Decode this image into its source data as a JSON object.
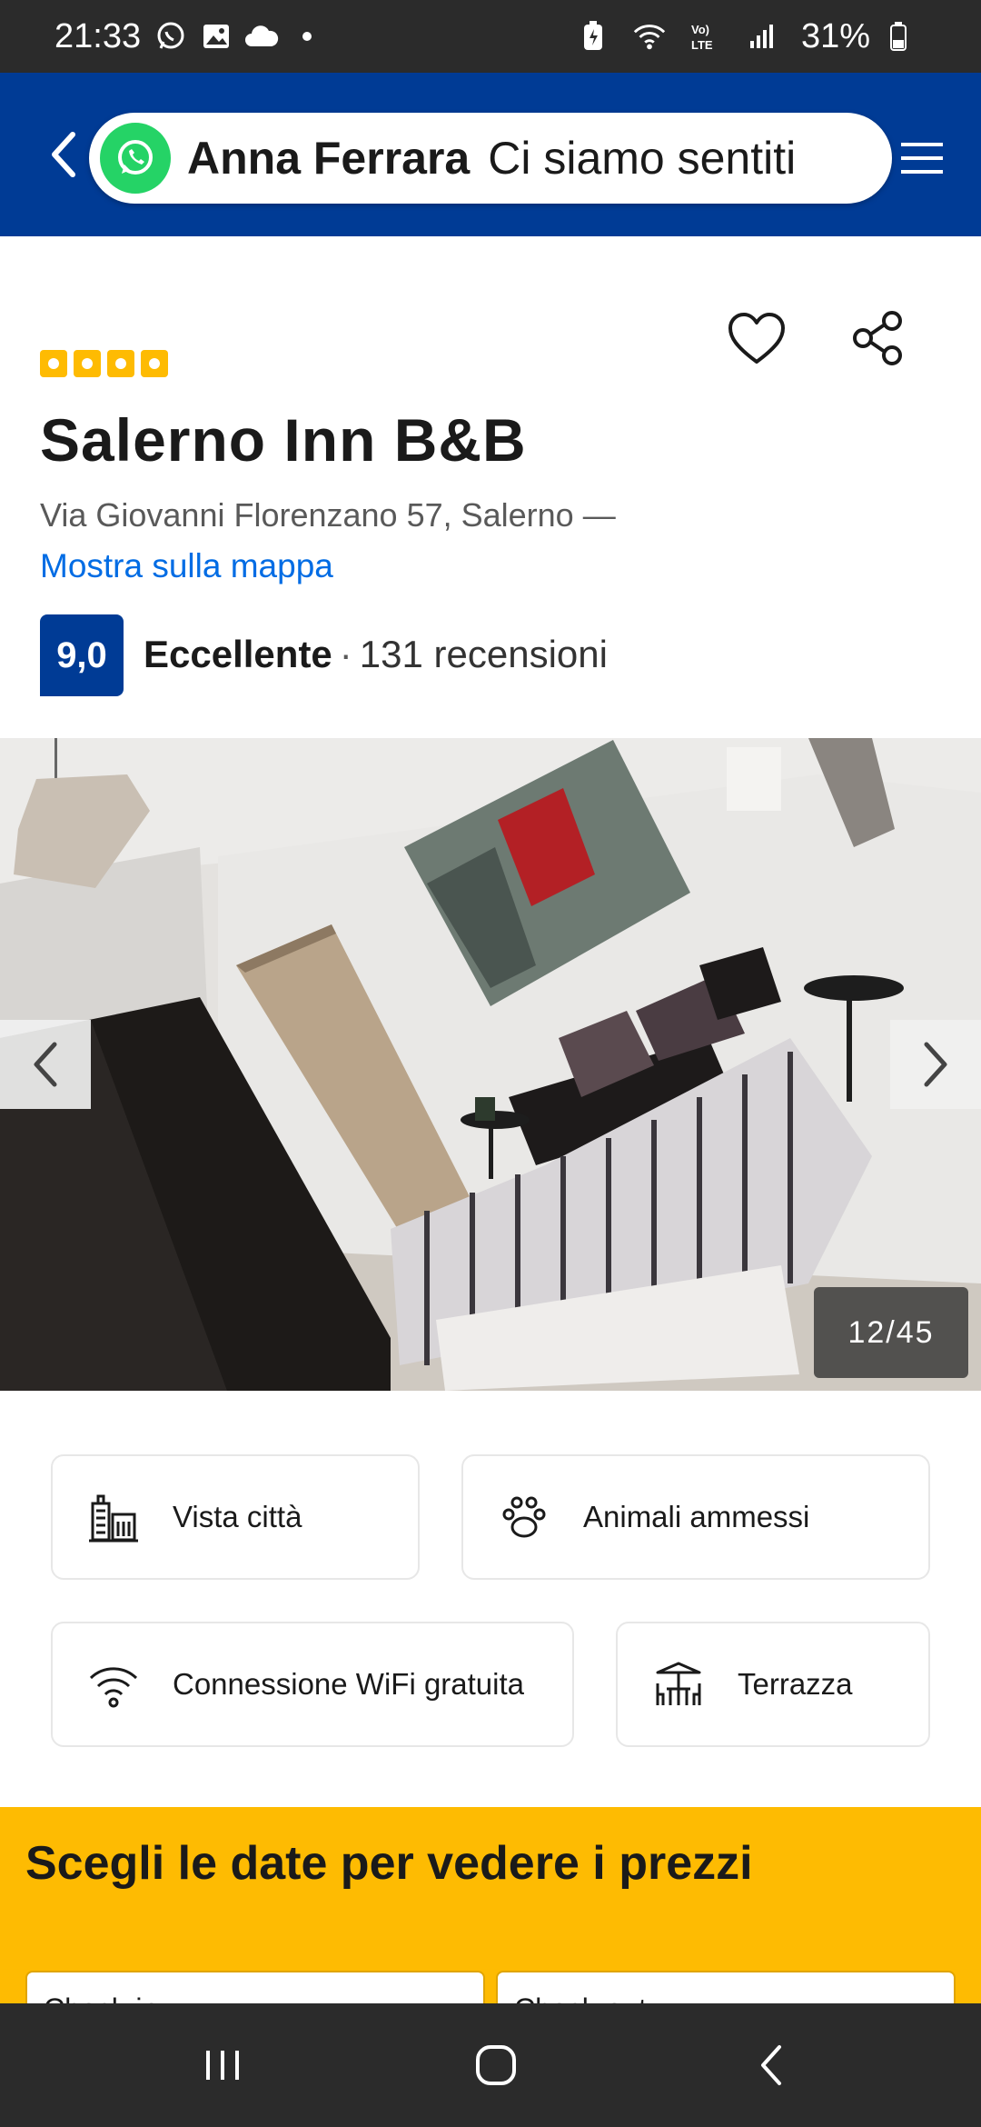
{
  "status_bar": {
    "time": "21:33",
    "battery": "31%",
    "icons": [
      "whatsapp-icon",
      "gallery-icon",
      "cloud-icon",
      "dot-icon",
      "battery-saver-icon",
      "wifi-icon",
      "volte-icon",
      "signal-icon",
      "battery-icon"
    ]
  },
  "notification": {
    "app_icon": "whatsapp-icon",
    "sender": "Anna Ferrara",
    "message": "Ci siamo sentiti"
  },
  "header": {
    "back_icon": "chevron-left-icon",
    "menu_icon": "hamburger-menu-icon",
    "color": "#003b95"
  },
  "property": {
    "stars": 4,
    "title": "Salerno Inn B&B",
    "address": "Via Giovanni Florenzano 57, Salerno —",
    "map_link": "Mostra sulla mappa",
    "score": "9,0",
    "rating_label": "Eccellente",
    "separator": "·",
    "reviews": "131 recensioni"
  },
  "gallery": {
    "counter": "12/45"
  },
  "facilities": [
    {
      "label": "Vista città",
      "icon": "city-view-icon"
    },
    {
      "label": "Animali ammessi",
      "icon": "paw-icon"
    },
    {
      "label": "Connessione WiFi gratuita",
      "icon": "wifi-icon"
    },
    {
      "label": "Terrazza",
      "icon": "terrace-icon"
    }
  ],
  "dates": {
    "title": "Scegli le date per vedere i prezzi",
    "checkin_label": "Check-in",
    "checkout_label": "Check-out",
    "color": "#febb02"
  },
  "nav_bar": {
    "icons": [
      "recent-apps-icon",
      "home-icon",
      "back-icon"
    ]
  }
}
